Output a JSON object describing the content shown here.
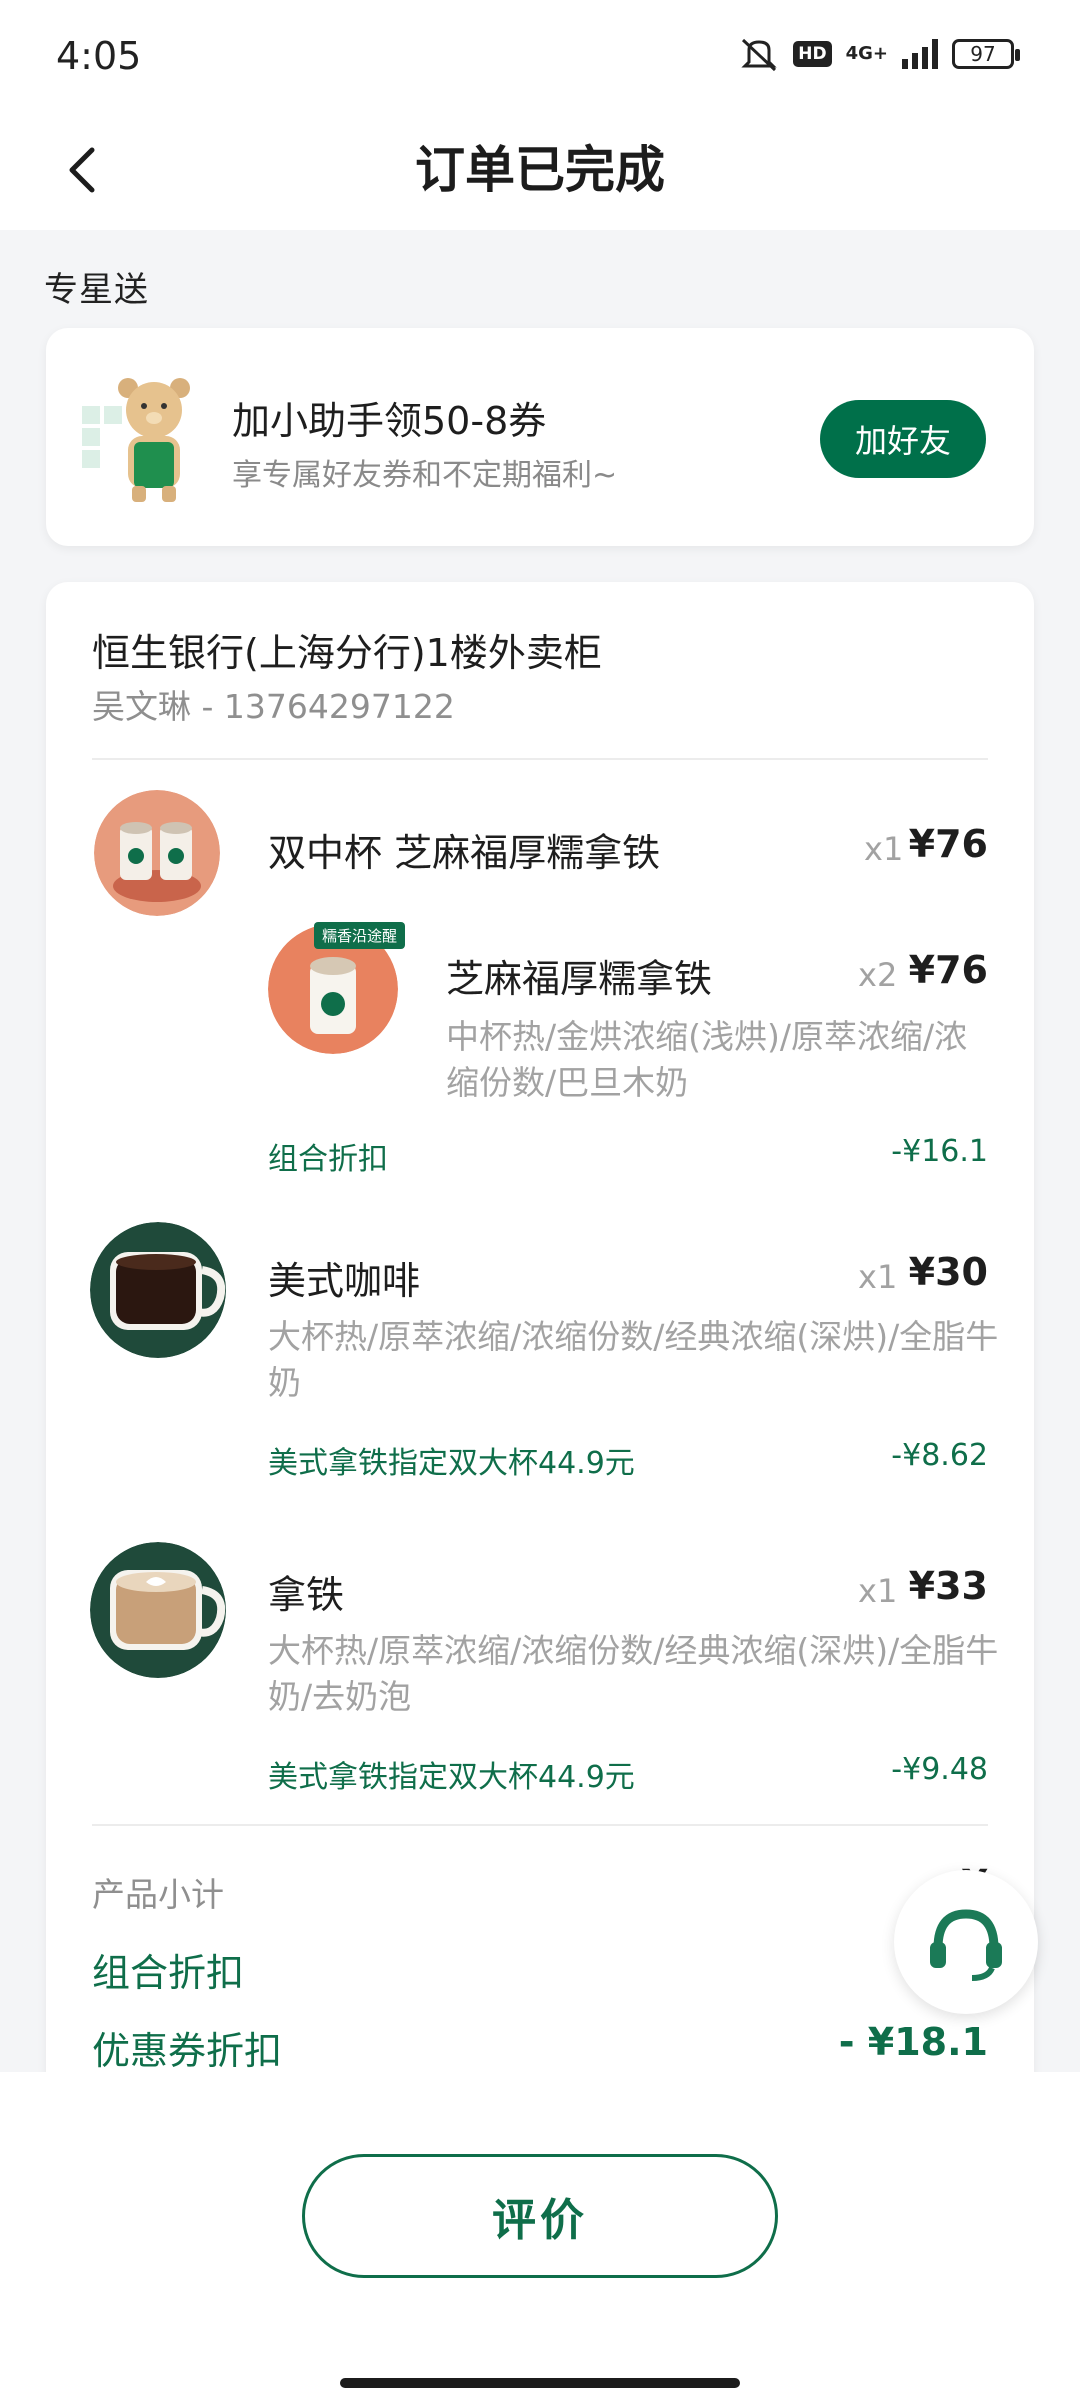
{
  "status_bar": {
    "time": "4:05",
    "network": "4G+",
    "hd": "HD",
    "battery": "97"
  },
  "header": {
    "title": "订单已完成"
  },
  "brand_label": "专星送",
  "promo": {
    "title": "加小助手领50-8券",
    "subtitle": "享专属好友券和不定期福利~",
    "button": "加好友"
  },
  "order": {
    "address": "恒生银行(上海分行)1楼外卖柜",
    "contact": "吴文琳 - 13764297122",
    "items": [
      {
        "name": "双中杯 芝麻福厚糯拿铁",
        "qty": "x1",
        "price": "¥76",
        "sub": {
          "badge": "糯香沿途醒",
          "name": "芝麻福厚糯拿铁",
          "qty": "x2",
          "price": "¥76",
          "spec": "中杯热/金烘浓缩(浅烘)/原萃浓缩/浓缩份数/巴旦木奶"
        },
        "discount_label": "组合折扣",
        "discount_value": "-¥16.1"
      },
      {
        "name": "美式咖啡",
        "qty": "x1",
        "price": "¥30",
        "spec": "大杯热/原萃浓缩/浓缩份数/经典浓缩(深烘)/全脂牛奶",
        "discount_label": "美式拿铁指定双大杯44.9元",
        "discount_value": "-¥8.62"
      },
      {
        "name": "拿铁",
        "qty": "x1",
        "price": "¥33",
        "spec": "大杯热/原萃浓缩/浓缩份数/经典浓缩(深烘)/全脂牛奶/去奶泡",
        "discount_label": "美式拿铁指定双大杯44.9元",
        "discount_value": "-¥9.48"
      }
    ],
    "summary": {
      "subtotal_label": "产品小计",
      "subtotal_value": "¥",
      "combo_label": "组合折扣",
      "combo_value": "- ¥",
      "coupon_label": "优惠券折扣",
      "coupon_value": "- ¥18.1"
    }
  },
  "bottom": {
    "review_button": "评价"
  },
  "colors": {
    "brand_green": "#00704a",
    "text_green": "#0f6e4a",
    "background": "#f4f5f7"
  }
}
